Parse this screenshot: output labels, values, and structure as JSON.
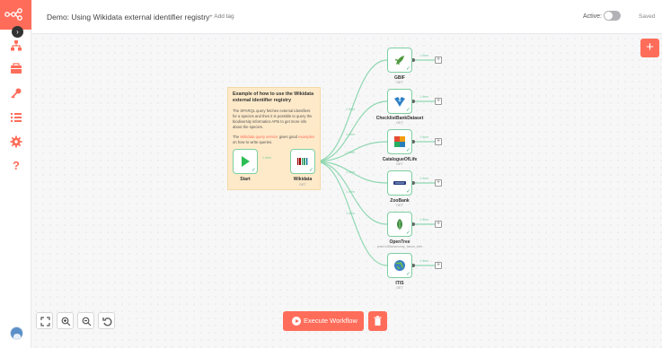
{
  "header": {
    "workflow_name": "Demo: Using Wikidata external identifier registry",
    "add_tag": "+ Add tag",
    "active_label": "Active:",
    "active": false,
    "saved": "Saved"
  },
  "sidebar": {
    "icons": [
      "workflows-icon",
      "templates-icon",
      "credentials-icon",
      "executions-icon",
      "settings-icon",
      "help-icon"
    ]
  },
  "sticky": {
    "title": "Example of how to use the Wikidata external identifier registry",
    "body": "The SPARQL query fetches external identifiers for a species and then it is possible to query the biodiversity informatics APIs to get more info about the species.",
    "note_prefix": "The",
    "note_link": "Wikidata query service",
    "note_mid": "gives good",
    "note_link2": "examples",
    "note_suffix": "on how to write queries."
  },
  "nodes": {
    "start": {
      "label": "Start"
    },
    "wikidata": {
      "label": "Wikidata",
      "sub": "GET"
    },
    "outputs": [
      {
        "label": "GBIF",
        "sub": "GET",
        "items": "1 item"
      },
      {
        "label": "ChecklistBankDataset",
        "sub": "GET",
        "items": "1 item"
      },
      {
        "label": "CatalogueOfLife",
        "sub": "GET",
        "items": "1 item"
      },
      {
        "label": "ZooBank",
        "sub": "GET",
        "items": "1 item"
      },
      {
        "label": "OpenTree",
        "sub": "post:/v3/taxonomy_taxon_info",
        "items": "1 item"
      },
      {
        "label": "ITIS",
        "sub": "GET",
        "items": "1 item"
      }
    ],
    "edge_label": "1 item"
  },
  "controls": {
    "execute_label": "Execute Workflow"
  },
  "colors": {
    "accent": "#ff6d5a",
    "success": "#7ccfa0",
    "sticky": "#feeac9"
  }
}
